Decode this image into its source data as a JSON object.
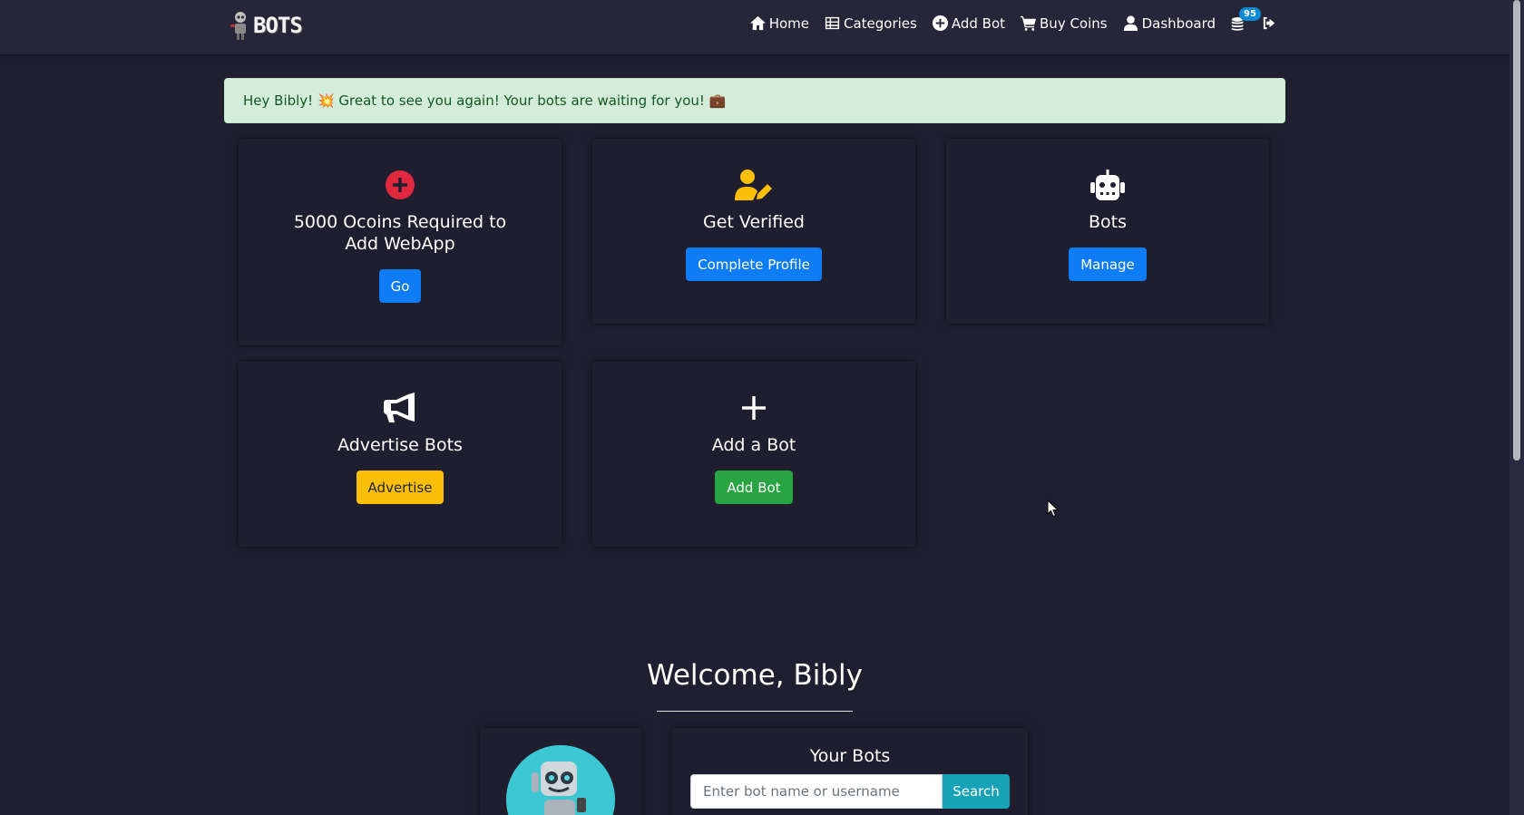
{
  "brand": {
    "name": "BOTS"
  },
  "nav": {
    "home": "Home",
    "categories": "Categories",
    "add_bot": "Add Bot",
    "buy_coins": "Buy Coins",
    "dashboard": "Dashboard",
    "coin_count": "95"
  },
  "alert": {
    "message": "Hey Bibly! 💥 Great to see you again! Your bots are waiting for you! 💼"
  },
  "cards": {
    "ocoins": {
      "title": "5000 Ocoins Required to Add WebApp",
      "button": "Go",
      "icon": "plus-circle-icon",
      "icon_color": "#e0293f"
    },
    "verify": {
      "title": "Get Verified",
      "button": "Complete Profile",
      "icon": "user-edit-icon",
      "icon_color": "#fbbf0a"
    },
    "bots": {
      "title": "Bots",
      "button": "Manage",
      "icon": "robot-icon"
    },
    "advertise": {
      "title": "Advertise Bots",
      "button": "Advertise",
      "icon": "megaphone-icon"
    },
    "add": {
      "title": "Add a Bot",
      "button": "Add Bot",
      "icon": "plus-icon"
    }
  },
  "welcome": {
    "heading": "Welcome, Bibly"
  },
  "your_bots": {
    "title": "Your Bots",
    "search_placeholder": "Enter bot name or username",
    "search_button": "Search"
  },
  "colors": {
    "background": "#1f1f30",
    "navbar": "#262638",
    "primary": "#0d7cf5",
    "warning": "#fbbf0a",
    "success": "#28a443",
    "info": "#17a2b8",
    "alert_bg": "#d4edda"
  }
}
